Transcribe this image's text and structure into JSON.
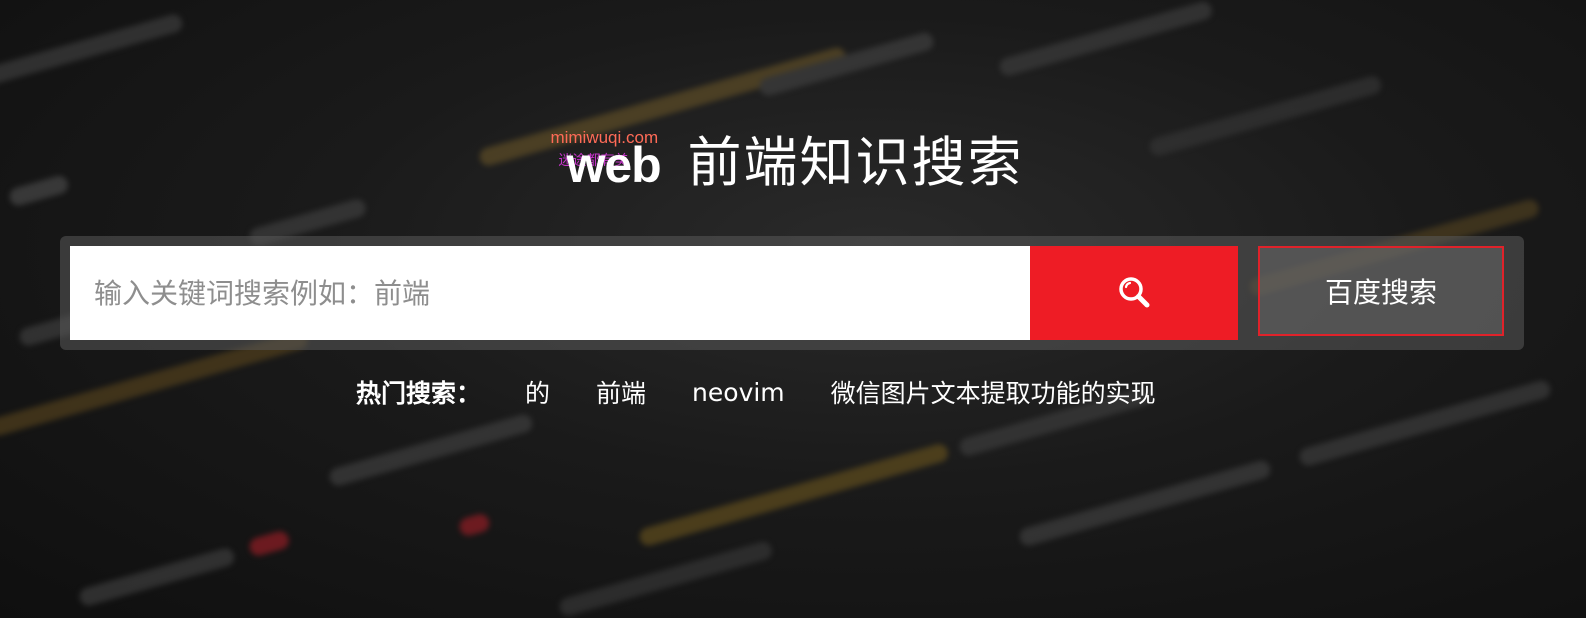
{
  "logo": {
    "main": "web",
    "watermark": "mimiwuqi.com",
    "watermark_sub": "迷途都有美"
  },
  "page_title": "前端知识搜索",
  "search": {
    "placeholder": "输入关键词搜索例如：前端",
    "value": ""
  },
  "search_button": {
    "icon": "search-icon"
  },
  "baidu_button": {
    "label": "百度搜索"
  },
  "hot": {
    "label": "热门搜索：",
    "items": [
      {
        "text": "的"
      },
      {
        "text": "前端"
      },
      {
        "text": "neovim"
      },
      {
        "text": "微信图片文本提取功能的实现"
      }
    ]
  },
  "colors": {
    "accent": "#ee1c25",
    "text": "#ffffff",
    "placeholder": "#8e8e8e"
  }
}
